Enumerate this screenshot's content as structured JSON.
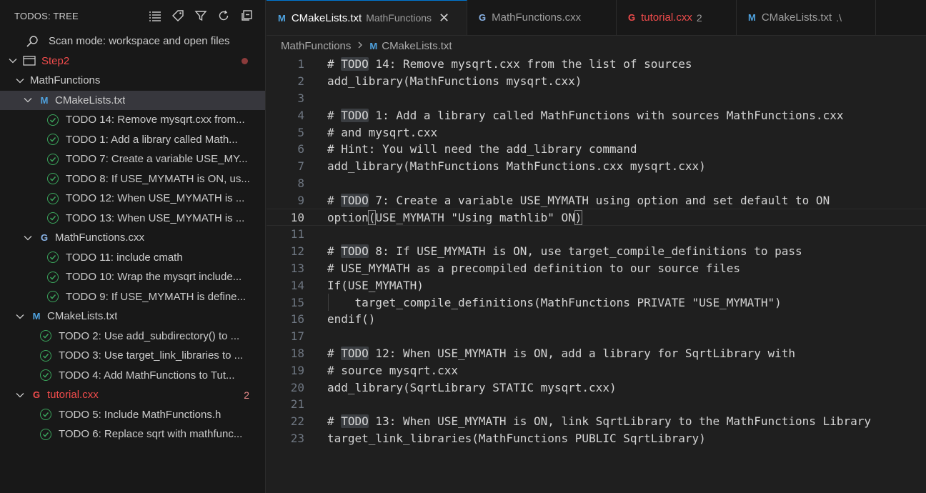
{
  "sidebar": {
    "title": "TODOS: TREE",
    "scan_mode": "Scan mode: workspace and open files",
    "step": "Step2",
    "folder": "MathFunctions",
    "file1": "CMakeLists.txt",
    "file1_todos": [
      "TODO 14: Remove mysqrt.cxx from...",
      "TODO 1: Add a library called Math...",
      "TODO 7: Create a variable USE_MY...",
      "TODO 8: If USE_MYMATH is ON, us...",
      "TODO 12: When USE_MYMATH is ...",
      "TODO 13: When USE_MYMATH is ..."
    ],
    "file2": "MathFunctions.cxx",
    "file2_todos": [
      "TODO 11: include cmath",
      "TODO 10: Wrap the mysqrt include...",
      "TODO 9: If USE_MYMATH is define..."
    ],
    "file3": "CMakeLists.txt",
    "file3_todos": [
      "TODO 2: Use add_subdirectory() to ...",
      "TODO 3: Use target_link_libraries to ...",
      "TODO 4: Add MathFunctions to Tut..."
    ],
    "file4": "tutorial.cxx",
    "file4_badge": "2",
    "file4_todos": [
      "TODO 5: Include MathFunctions.h",
      "TODO 6: Replace sqrt with mathfunc..."
    ]
  },
  "tabs": [
    {
      "icon": "M",
      "label": "CMakeLists.txt",
      "desc": "MathFunctions",
      "active": true
    },
    {
      "icon": "G",
      "label": "MathFunctions.cxx",
      "desc": ""
    },
    {
      "icon": "G",
      "label": "tutorial.cxx",
      "desc": "2"
    },
    {
      "icon": "M",
      "label": "CMakeLists.txt",
      "desc": ".\\"
    }
  ],
  "breadcrumb": {
    "folder": "MathFunctions",
    "file": "CMakeLists.txt"
  },
  "code": [
    {
      "n": "1",
      "pre": "# ",
      "todo": "TODO",
      "post": " 14: Remove mysqrt.cxx from the list of sources"
    },
    {
      "n": "2",
      "pre": "add_library(MathFunctions mysqrt.cxx)"
    },
    {
      "n": "3",
      "pre": ""
    },
    {
      "n": "4",
      "pre": "# ",
      "todo": "TODO",
      "post": " 1: Add a library called MathFunctions with sources MathFunctions.cxx"
    },
    {
      "n": "5",
      "pre": "# and mysqrt.cxx"
    },
    {
      "n": "6",
      "pre": "# Hint: You will need the add_library command"
    },
    {
      "n": "7",
      "pre": "add_library(MathFunctions MathFunctions.cxx mysqrt.cxx)"
    },
    {
      "n": "8",
      "pre": ""
    },
    {
      "n": "9",
      "pre": "# ",
      "todo": "TODO",
      "post": " 7: Create a variable USE_MYMATH using option and set default to ON"
    },
    {
      "n": "10",
      "pre": "option",
      "br1": "(",
      "mid": "USE_MYMATH \"Using mathlib\" ON",
      "br2": ")",
      "current": true
    },
    {
      "n": "11",
      "pre": ""
    },
    {
      "n": "12",
      "pre": "# ",
      "todo": "TODO",
      "post": " 8: If USE_MYMATH is ON, use target_compile_definitions to pass"
    },
    {
      "n": "13",
      "pre": "# USE_MYMATH as a precompiled definition to our source files"
    },
    {
      "n": "14",
      "pre": "If(USE_MYMATH)"
    },
    {
      "n": "15",
      "pre": "    target_compile_definitions(MathFunctions PRIVATE \"USE_MYMATH\")",
      "indent": true
    },
    {
      "n": "16",
      "pre": "endif()"
    },
    {
      "n": "17",
      "pre": ""
    },
    {
      "n": "18",
      "pre": "# ",
      "todo": "TODO",
      "post": " 12: When USE_MYMATH is ON, add a library for SqrtLibrary with"
    },
    {
      "n": "19",
      "pre": "# source mysqrt.cxx"
    },
    {
      "n": "20",
      "pre": "add_library(SqrtLibrary STATIC mysqrt.cxx)"
    },
    {
      "n": "21",
      "pre": ""
    },
    {
      "n": "22",
      "pre": "# ",
      "todo": "TODO",
      "post": " 13: When USE_MYMATH is ON, link SqrtLibrary to the MathFunctions Library"
    },
    {
      "n": "23",
      "pre": "target_link_libraries(MathFunctions PUBLIC SqrtLibrary)"
    }
  ]
}
